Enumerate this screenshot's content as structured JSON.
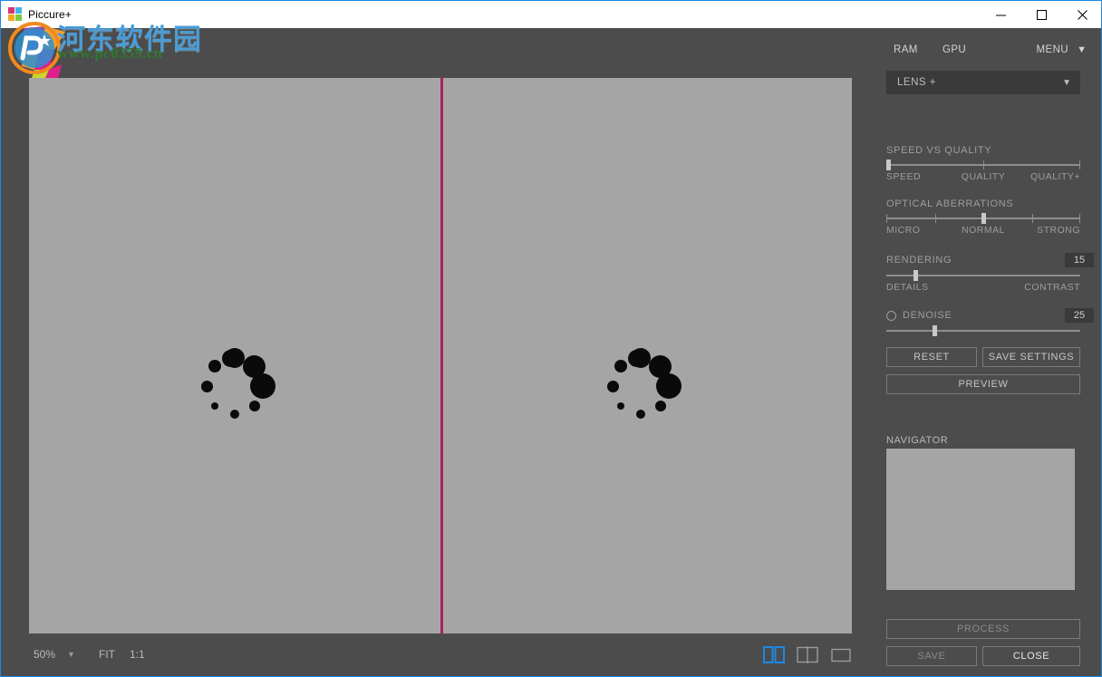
{
  "window": {
    "title": "Piccure+",
    "controls": {
      "minimize": "minimize-button",
      "maximize": "maximize-button",
      "close": "close-button"
    }
  },
  "brand": {
    "name": "piccure",
    "superscript": "+"
  },
  "watermark": {
    "chinese": "河东软件园",
    "url": "www.pc0359.cn",
    "chinese_color": "#4a9cd6",
    "url_color": "#2f7a2f"
  },
  "canvas": {
    "background_color": "#a5a5a5",
    "divider_color": "#b01f5f",
    "spinner_count": 2,
    "spinner_state": "loading"
  },
  "footer": {
    "zoom_value": "50%",
    "zoom_caret": "▼",
    "fit_label": "FIT",
    "actual_size_label": "1:1",
    "view_modes": [
      {
        "name": "split-view",
        "active": true,
        "color": "#1a8ae5"
      },
      {
        "name": "side-by-side-view",
        "active": false,
        "color": "#9a9a9a"
      },
      {
        "name": "single-view",
        "active": false,
        "color": "#9a9a9a"
      }
    ]
  },
  "sidebar": {
    "ram_label": "RAM",
    "gpu_label": "GPU",
    "menu_label": "MENU",
    "menu_caret": "▼",
    "lens": {
      "selected": "LENS +",
      "caret": "▼"
    },
    "speed_vs_quality": {
      "title": "SPEED VS QUALITY",
      "labels": [
        "SPEED",
        "QUALITY",
        "QUALITY+"
      ],
      "value_percent": 0
    },
    "optical_aberrations": {
      "title": "OPTICAL ABERRATIONS",
      "labels": [
        "MICRO",
        "NORMAL",
        "STRONG"
      ],
      "value_percent": 50
    },
    "rendering": {
      "title": "RENDERING",
      "value": "15",
      "labels": [
        "DETAILS",
        "CONTRAST"
      ],
      "value_percent": 15
    },
    "denoise": {
      "title": "DENOISE",
      "value": "25",
      "enabled": false,
      "value_percent": 25
    },
    "buttons": {
      "reset": "RESET",
      "save_settings": "SAVE SETTINGS",
      "preview": "PREVIEW",
      "process": "PROCESS",
      "save": "SAVE",
      "close": "CLOSE"
    },
    "navigator": {
      "title": "NAVIGATOR"
    }
  }
}
